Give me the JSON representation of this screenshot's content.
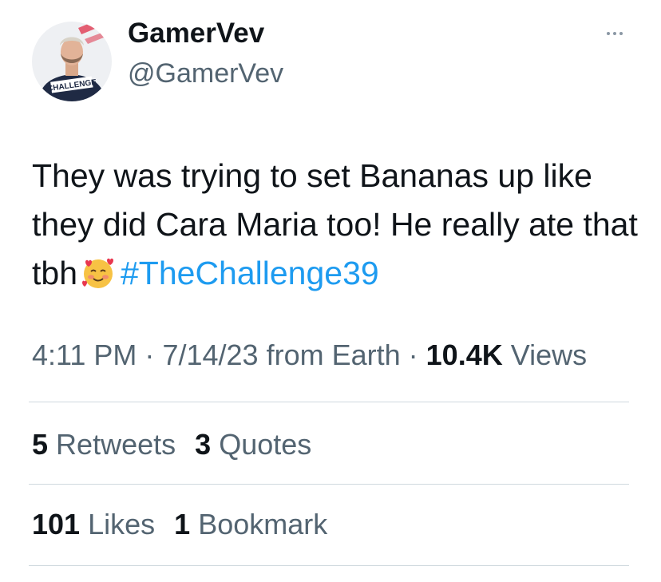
{
  "author": {
    "display_name": "GamerVev",
    "handle": "@GamerVev",
    "avatar_badge_text": "CHALLENGE"
  },
  "more_button": {
    "icon": "more-dots-icon"
  },
  "tweet": {
    "text_part1": "They was trying to set Bananas up like they did Cara Maria too! He really ate that tbh",
    "emoji": "smiling-face-with-hearts",
    "hashtag": "#TheChallenge39"
  },
  "meta": {
    "time": "4:11 PM",
    "sep1": "·",
    "date": "7/14/23",
    "source": "from Earth",
    "sep2": "·",
    "views_count": "10.4K",
    "views_label": "Views"
  },
  "engagement": {
    "retweets_count": "5",
    "retweets_label": "Retweets",
    "quotes_count": "3",
    "quotes_label": "Quotes",
    "likes_count": "101",
    "likes_label": "Likes",
    "bookmarks_count": "1",
    "bookmarks_label": "Bookmark"
  },
  "colors": {
    "text": "#0f1419",
    "secondary": "#536471",
    "link": "#1d9bf0",
    "divider": "#cfd9de"
  }
}
